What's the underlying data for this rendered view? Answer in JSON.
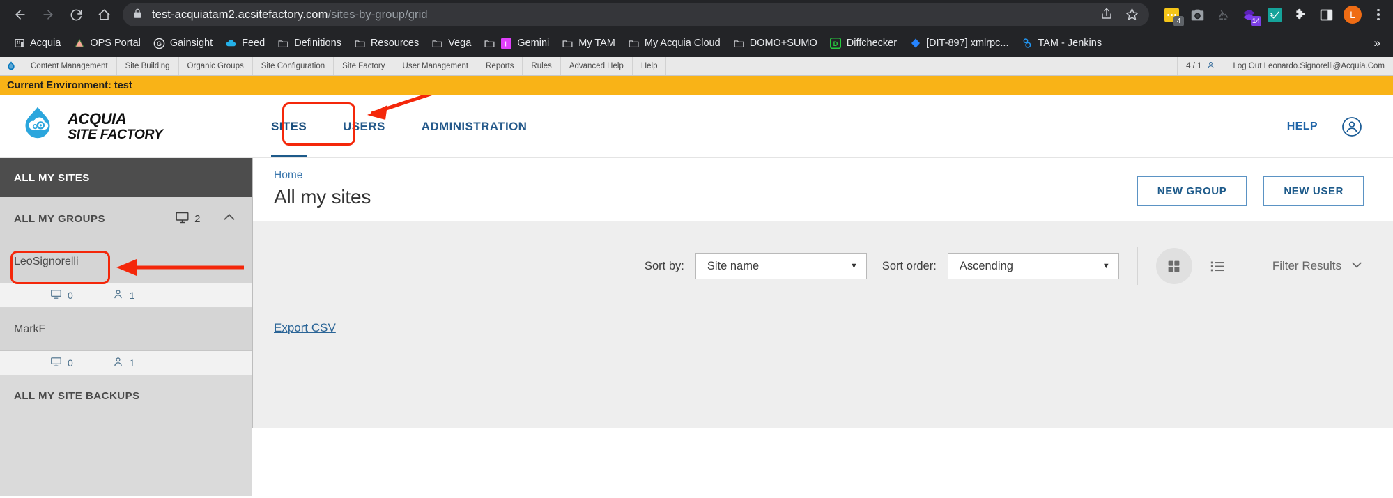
{
  "browser": {
    "url_domain": "test-acquiatam2.acsitefactory.com",
    "url_path": "/sites-by-group/grid",
    "nav": {
      "back": "back-arrow",
      "forward": "forward-arrow",
      "reload": "reload",
      "home": "home"
    },
    "omnibox_actions": [
      "share-icon",
      "bookmark-star-icon"
    ],
    "extensions": [
      {
        "name": "notes-extension",
        "badge": "4",
        "color": "#f5c518"
      },
      {
        "name": "screenshot-extension",
        "badge": "",
        "color": "#9aa0a6"
      },
      {
        "name": "recycle-extension",
        "badge": "",
        "color": "#5f6368"
      },
      {
        "name": "layers-extension",
        "badge": "14",
        "color": "#6d28d9"
      },
      {
        "name": "grammarly-extension",
        "badge": "",
        "color": "#15a39a"
      },
      {
        "name": "puzzle-extensions-icon",
        "badge": "",
        "color": "#e8eaed"
      },
      {
        "name": "side-panel-icon",
        "badge": "",
        "color": "#e8eaed"
      }
    ],
    "profile_initial": "L",
    "bookmarks": [
      {
        "label": "Acquia",
        "icon": "building-icon"
      },
      {
        "label": "OPS Portal",
        "icon": "triangle-icon"
      },
      {
        "label": "Gainsight",
        "icon": "gainsight-icon"
      },
      {
        "label": "Feed",
        "icon": "cloud-icon"
      },
      {
        "label": "Definitions",
        "icon": "folder-icon"
      },
      {
        "label": "Resources",
        "icon": "folder-icon"
      },
      {
        "label": "Vega",
        "icon": "folder-icon"
      },
      {
        "label": "Gemini",
        "icon": "gemini-icon"
      },
      {
        "label": "My TAM",
        "icon": "folder-icon"
      },
      {
        "label": "My Acquia Cloud",
        "icon": "folder-icon"
      },
      {
        "label": "DOMO+SUMO",
        "icon": "folder-icon"
      },
      {
        "label": "Diffchecker",
        "icon": "diffchecker-icon"
      },
      {
        "label": "[DIT-897] xmlrpc...",
        "icon": "jira-icon"
      },
      {
        "label": "TAM - Jenkins",
        "icon": "jenkins-icon"
      }
    ],
    "bookmarks_overflow": "»"
  },
  "admin_toolbar": {
    "logo": "drupal-drop-icon",
    "items": [
      "Content Management",
      "Site Building",
      "Organic Groups",
      "Site Configuration",
      "Site Factory",
      "User Management",
      "Reports",
      "Rules",
      "Advanced Help",
      "Help"
    ],
    "count": "4 / 1",
    "count_icon": "user-icon",
    "logout": "Log Out Leonardo.Signorelli@Acquia.Com"
  },
  "env_bar": {
    "text": "Current Environment: test",
    "color": "#f9b317"
  },
  "site_header": {
    "logo_line1": "ACQUIA",
    "logo_line2": "SITE FACTORY",
    "logo_icon": "acquia-droplet-icon",
    "tabs": [
      {
        "label": "SITES",
        "active": true
      },
      {
        "label": "USERS",
        "active": false
      },
      {
        "label": "ADMINISTRATION",
        "active": false
      }
    ],
    "help_label": "HELP",
    "user_icon": "user-circle-icon",
    "accent": "#1d5a8a"
  },
  "sidebar": {
    "all_my_sites": "ALL MY SITES",
    "all_my_groups": "ALL MY GROUPS",
    "groups_site_count": "2",
    "groups_icon": "monitor-icon",
    "collapse_icon": "chevron-up-icon",
    "groups": [
      {
        "name": "LeoSignorelli",
        "sites": "0",
        "users": "1",
        "sites_icon": "monitor-icon",
        "users_icon": "person-icon",
        "highlighted": true
      },
      {
        "name": "MarkF",
        "sites": "0",
        "users": "1",
        "sites_icon": "monitor-icon",
        "users_icon": "person-icon",
        "highlighted": false
      }
    ],
    "all_my_site_backups": "ALL MY SITE BACKUPS"
  },
  "main": {
    "breadcrumb": "Home",
    "title": "All my sites",
    "new_group_label": "NEW GROUP",
    "new_user_label": "NEW USER",
    "sort_by_label": "Sort by:",
    "sort_by_value": "Site name",
    "sort_order_label": "Sort order:",
    "sort_order_value": "Ascending",
    "grid_view_icon": "grid-view-icon",
    "list_view_icon": "list-view-icon",
    "filter_results_label": "Filter Results",
    "filter_chevron_icon": "chevron-down-icon",
    "export_csv": "Export CSV",
    "link_color": "#2a6496"
  },
  "annotations": {
    "color": "#f4270a",
    "boxes": [
      "sites-tab-highlight",
      "leosignorelli-group-highlight"
    ],
    "arrows": [
      "arrow-to-sites-tab",
      "arrow-to-leosignorelli"
    ]
  }
}
